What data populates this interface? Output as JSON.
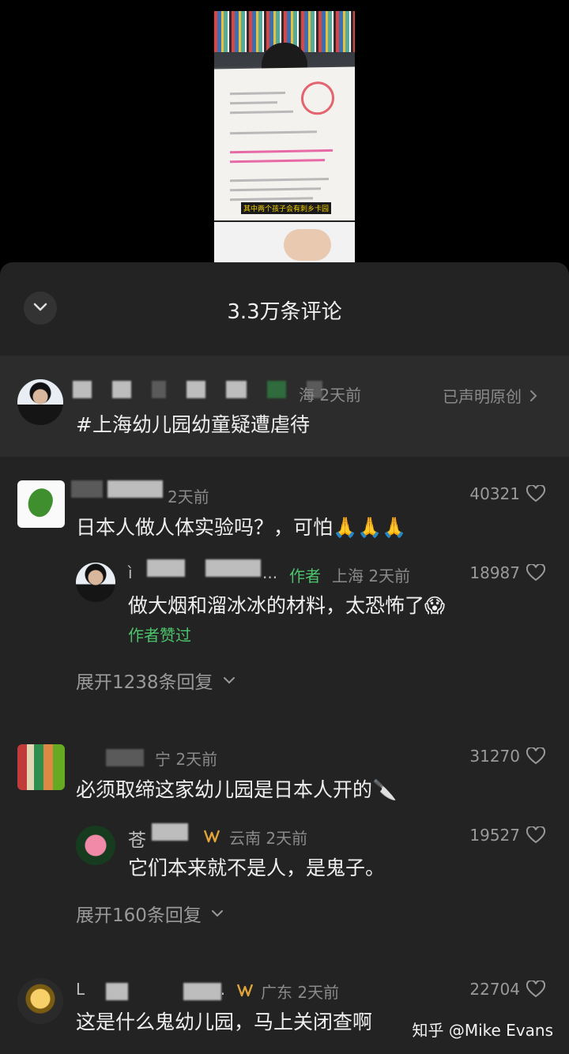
{
  "video": {
    "caption": "其中两个孩子会有刺乡卡园"
  },
  "header": {
    "title": "3.3万条评论",
    "collapse_icon": "chevron-down-icon"
  },
  "pinned": {
    "location_time": "海 2天前",
    "original_label": "已声明原创",
    "text": "#上海幼儿园幼童疑遭虐待"
  },
  "comments": [
    {
      "time": "2天前",
      "likes": "40321",
      "text": "日本人做人体实验吗？，可怕🙏🙏🙏",
      "reply": {
        "author_prefix": "ì",
        "ellipsis": "...",
        "author_tag": "作者",
        "location_time": "上海 2天前",
        "likes": "18987",
        "text": "做大烟和溜冰冰的材料，太恐怖了😱",
        "liked_by_author": "作者赞过"
      },
      "expand": "展开1238条回复"
    },
    {
      "location_time": "宁 2天前",
      "likes": "31270",
      "text": "必须取缔这家幼儿园是日本人开的🔪",
      "reply": {
        "author_prefix": "苍",
        "location_time": "云南 2天前",
        "likes": "19527",
        "text": "它们本来就不是人，是鬼子。"
      },
      "expand": "展开160条回复"
    },
    {
      "author_prefix": "L",
      "ellipsis": "...",
      "location_time": "广东 2天前",
      "likes": "22704",
      "text": "这是什么鬼幼儿园，马上关闭查啊"
    }
  ],
  "watermark": "知乎 @Mike Evans"
}
